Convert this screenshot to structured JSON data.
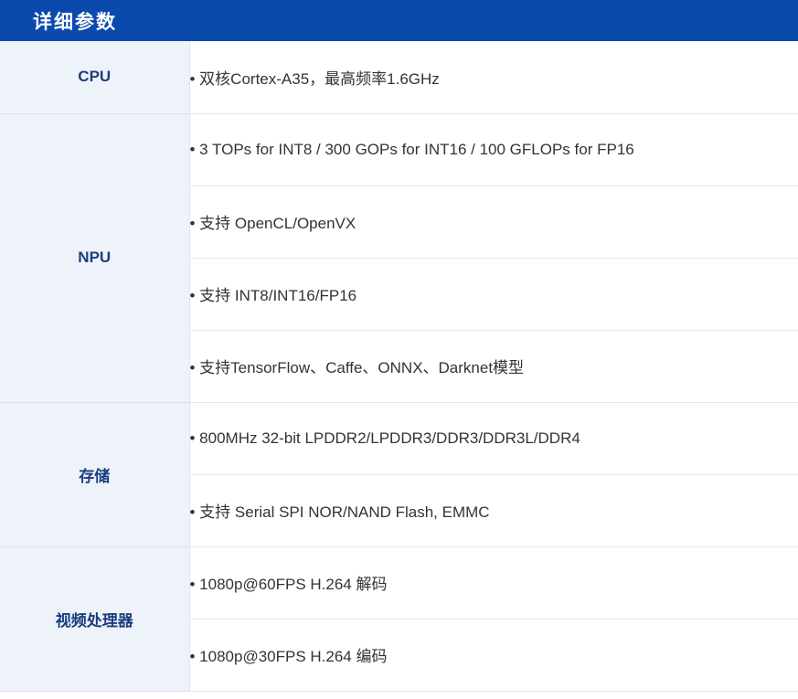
{
  "header": {
    "title": "详细参数"
  },
  "rows": [
    {
      "label": "CPU",
      "values": [
        "• 双核Cortex-A35，最高频率1.6GHz"
      ]
    },
    {
      "label": "NPU",
      "values": [
        "• 3 TOPs for INT8 / 300 GOPs for INT16 / 100 GFLOPs for FP16",
        "• 支持 OpenCL/OpenVX",
        "• 支持 INT8/INT16/FP16",
        "• 支持TensorFlow、Caffe、ONNX、Darknet模型"
      ]
    },
    {
      "label": "存储",
      "values": [
        "• 800MHz 32-bit LPDDR2/LPDDR3/DDR3/DDR3L/DDR4",
        "• 支持 Serial SPI NOR/NAND Flash, EMMC"
      ]
    },
    {
      "label": "视频处理器",
      "values": [
        "• 1080p@60FPS H.264 解码",
        "• 1080p@30FPS H.264 编码"
      ]
    }
  ],
  "colors": {
    "header_bg": "#0a4aad",
    "label_bg": "#eef3fa",
    "label_text": "#1b3d80",
    "value_text": "#333333"
  }
}
